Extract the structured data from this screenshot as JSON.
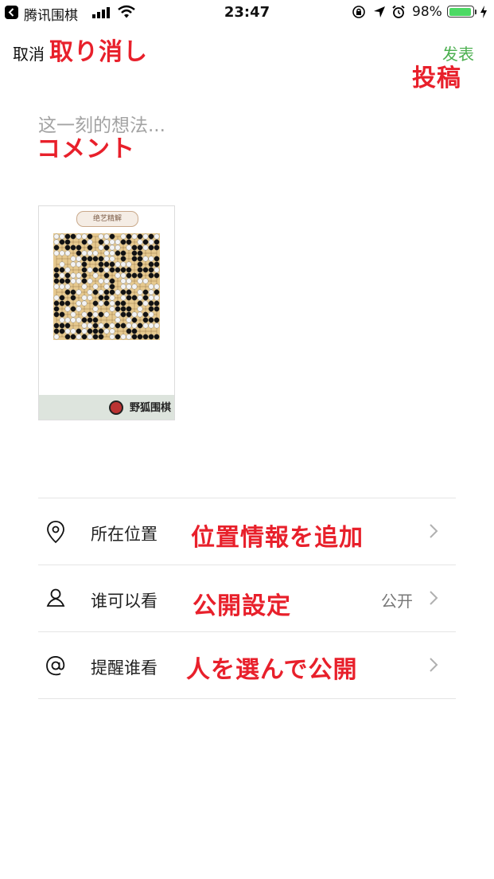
{
  "status_bar": {
    "carrier": "腾讯围棋",
    "time": "23:47",
    "battery": "98%"
  },
  "nav": {
    "cancel_label": "取消",
    "publish_label": "发表",
    "publish_color": "#4caf50"
  },
  "post": {
    "placeholder": "这一刻的想法..."
  },
  "image_card": {
    "label": "绝艺精解",
    "brand": "野狐围棋"
  },
  "options": [
    {
      "label": "所在位置",
      "value": "",
      "icon": "location-pin-icon"
    },
    {
      "label": "谁可以看",
      "value": "公开",
      "icon": "person-icon"
    },
    {
      "label": "提醒谁看",
      "value": "",
      "icon": "at-sign-icon"
    }
  ],
  "annotations": {
    "cancel": "取り消し",
    "publish": "投稿",
    "comment": "コメント",
    "location": "位置情報を追加",
    "visibility": "公開設定",
    "mention": "人を選んで公開",
    "color": "#e8202b"
  }
}
